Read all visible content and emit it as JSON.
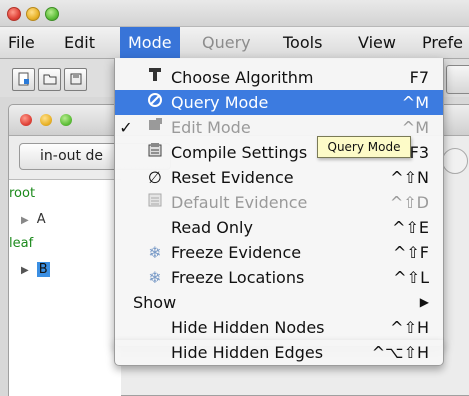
{
  "menubar": {
    "items": [
      {
        "label": "File"
      },
      {
        "label": "Edit"
      },
      {
        "label": "Mode"
      },
      {
        "label": "Query"
      },
      {
        "label": "Tools"
      },
      {
        "label": "View"
      },
      {
        "label": "Prefe"
      }
    ]
  },
  "inner_window": {
    "evidence_button": "in-out de",
    "tree": {
      "root": "root",
      "node_a": "A",
      "leaf": "leaf",
      "node_b": "B"
    }
  },
  "mode_menu": {
    "items": [
      {
        "label": "Choose Algorithm",
        "shortcut": "F7",
        "icon": "algorithm-icon"
      },
      {
        "label": "Query Mode",
        "shortcut": "^M",
        "icon": "query-mode-icon"
      },
      {
        "label": "Edit Mode",
        "shortcut": "^M",
        "icon": "edit-mode-icon",
        "check": "✓"
      },
      {
        "label": "Compile Settings",
        "shortcut": "F3",
        "icon": "compile-settings-icon"
      },
      {
        "label": "Reset Evidence",
        "shortcut": "^⇧N",
        "icon": "reset-icon"
      },
      {
        "label": "Default Evidence",
        "shortcut": "^⇧D",
        "icon": "default-evidence-icon"
      },
      {
        "label": "Read Only",
        "shortcut": "^⇧E"
      },
      {
        "label": "Freeze Evidence",
        "shortcut": "^⇧F",
        "icon": "freeze-icon"
      },
      {
        "label": "Freeze Locations",
        "shortcut": "^⇧L",
        "icon": "freeze-icon"
      },
      {
        "label": "Show",
        "submenu_arrow": "▶"
      },
      {
        "label": "Hide Hidden Nodes",
        "shortcut": "^⇧H"
      },
      {
        "label": "Hide Hidden Edges",
        "shortcut": "^⌥⇧H"
      }
    ]
  },
  "tooltip": {
    "text": "Query Mode"
  },
  "colors": {
    "highlight": "#3c7be0",
    "tree_green": "#1c8a1c",
    "selection": "#3b8fe3"
  }
}
